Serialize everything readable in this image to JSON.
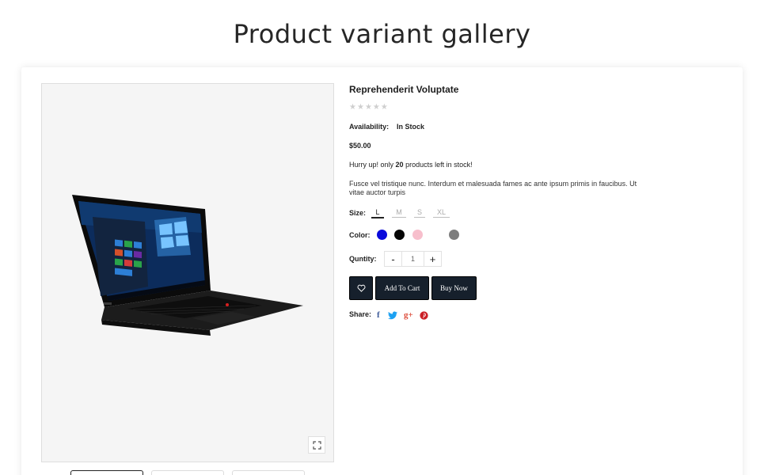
{
  "page": {
    "heading": "Product variant gallery"
  },
  "product": {
    "title": "Reprehenderit Voluptate",
    "rating": {
      "value": 0,
      "max": 5
    },
    "availability_label": "Availability:",
    "availability_value": "In Stock",
    "price": "$50.00",
    "stock_notice": {
      "prefix": "Hurry up! only",
      "count": "20",
      "suffix": "products left in stock!"
    },
    "description": "Fusce vel tristique nunc. Interdum et malesuada fames ac ante ipsum primis in faucibus. Ut vitae auctor turpis"
  },
  "options": {
    "size_label": "Size:",
    "sizes": [
      {
        "label": "L",
        "selected": true
      },
      {
        "label": "M",
        "selected": false
      },
      {
        "label": "S",
        "selected": false
      },
      {
        "label": "XL",
        "selected": false
      }
    ],
    "color_label": "Color:",
    "colors": [
      "#0a0adb",
      "#050505",
      "#f7bfcc",
      "#ffffff",
      "#7d7d7d"
    ],
    "quantity_label": "Quntity:",
    "quantity_value": "1",
    "minus": "-",
    "plus": "+"
  },
  "actions": {
    "wishlist_icon": "heart-icon",
    "add_to_cart": "Add To Cart",
    "buy_now": "Buy Now"
  },
  "share": {
    "label": "Share:",
    "networks": [
      {
        "name": "facebook-icon",
        "glyph": "f",
        "color": "#3b5998"
      },
      {
        "name": "twitter-icon",
        "glyph": "twitter",
        "color": "#1da1f2"
      },
      {
        "name": "google-plus-icon",
        "glyph": "g+",
        "color": "#dd4b39"
      },
      {
        "name": "pinterest-icon",
        "glyph": "p",
        "color": "#cb2027"
      }
    ]
  },
  "gallery": {
    "thumbnails": [
      {
        "active": true
      },
      {
        "active": false
      },
      {
        "active": false
      }
    ]
  }
}
